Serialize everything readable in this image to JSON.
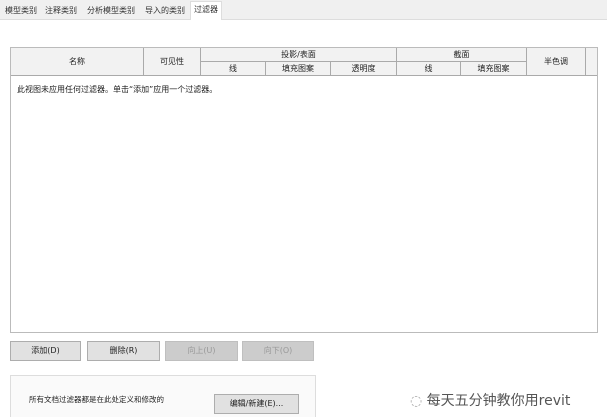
{
  "tabs": [
    "模型类别",
    "注释类别",
    "分析模型类别",
    "导入的类别",
    "过滤器"
  ],
  "active_tab": "过滤器",
  "table": {
    "headers": {
      "name": "名称",
      "visibility": "可见性",
      "projection": "投影/表面",
      "proj_line": "线",
      "proj_fill": "填充图案",
      "proj_transparency": "透明度",
      "cut": "截面",
      "cut_line": "线",
      "cut_fill": "填充图案",
      "halftone": "半色调"
    },
    "empty_message": "此视图未应用任何过滤器。单击“添加”应用一个过滤器。"
  },
  "buttons": {
    "add": "添加(D)",
    "delete": "删除(R)",
    "up": "向上(U)",
    "down": "向下(O)",
    "edit_new": "编辑/新建(E)..."
  },
  "footer_note": "所有文档过滤器都是在此处定义和修改的",
  "watermark": "每天五分钟教你用revit"
}
